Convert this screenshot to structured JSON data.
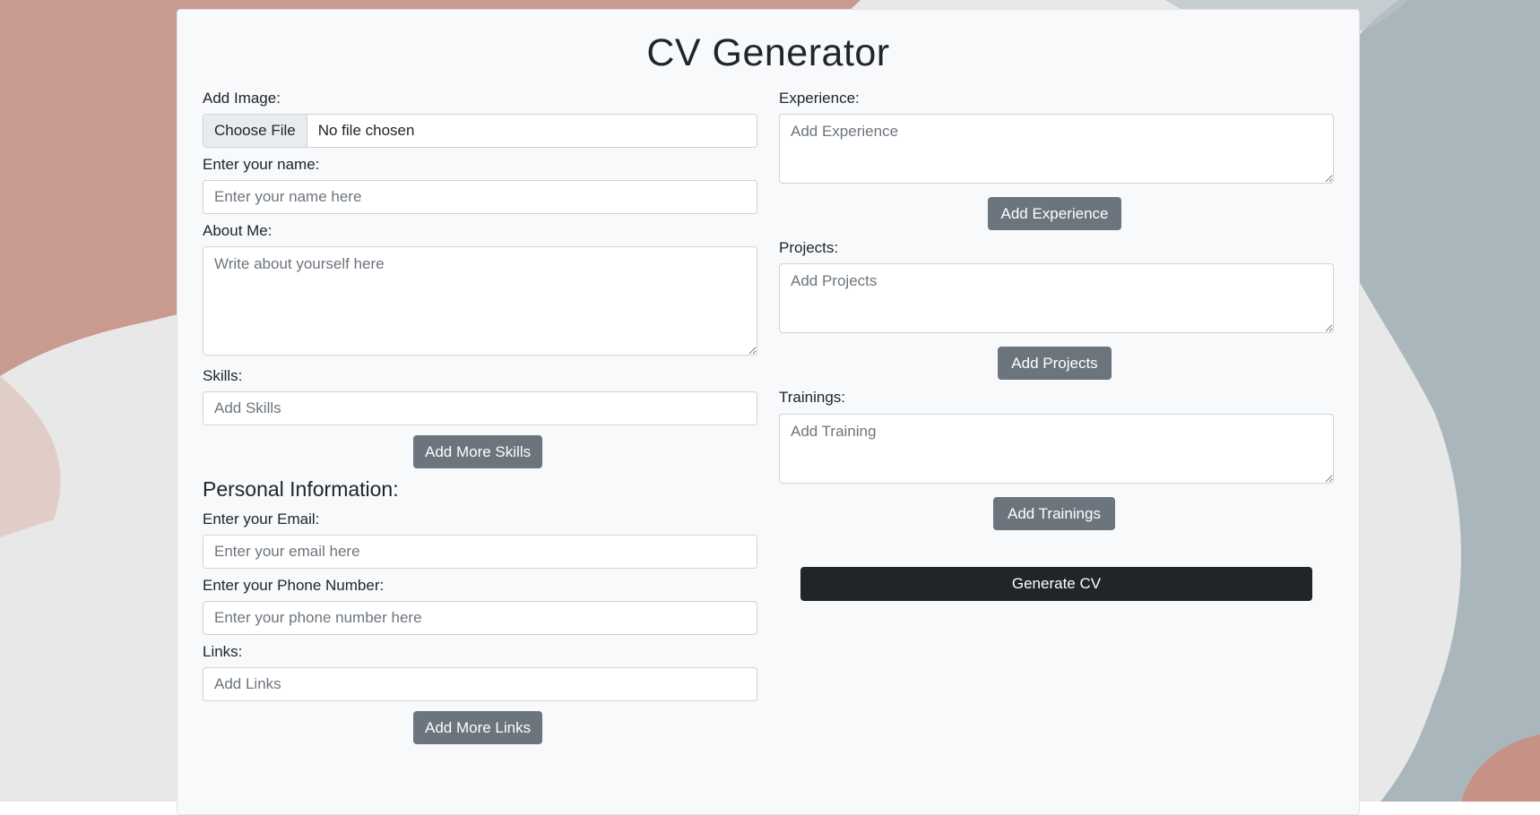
{
  "page": {
    "title": "CV Generator"
  },
  "left": {
    "image": {
      "label": "Add Image:",
      "choose_label": "Choose File",
      "status": "No file chosen"
    },
    "name": {
      "label": "Enter your name:",
      "placeholder": "Enter your name here"
    },
    "about": {
      "label": "About Me:",
      "placeholder": "Write about yourself here"
    },
    "skills": {
      "label": "Skills:",
      "placeholder": "Add Skills",
      "button": "Add More Skills"
    },
    "personal_heading": "Personal Information:",
    "email": {
      "label": "Enter your Email:",
      "placeholder": "Enter your email here"
    },
    "phone": {
      "label": "Enter your Phone Number:",
      "placeholder": "Enter your phone number here"
    },
    "links": {
      "label": "Links:",
      "placeholder": "Add Links",
      "button": "Add More Links"
    }
  },
  "right": {
    "experience": {
      "label": "Experience:",
      "placeholder": "Add Experience",
      "button": "Add Experience"
    },
    "projects": {
      "label": "Projects:",
      "placeholder": "Add Projects",
      "button": "Add Projects"
    },
    "trainings": {
      "label": "Trainings:",
      "placeholder": "Add Training",
      "button": "Add Trainings"
    },
    "generate_button": "Generate CV"
  },
  "colors": {
    "secondary_button": "#6c757d",
    "dark_button": "#212529",
    "card_background": "#f8f9fa",
    "background_blob_pink": "#c99a8f",
    "background_blob_blue": "#a9b7bd"
  }
}
